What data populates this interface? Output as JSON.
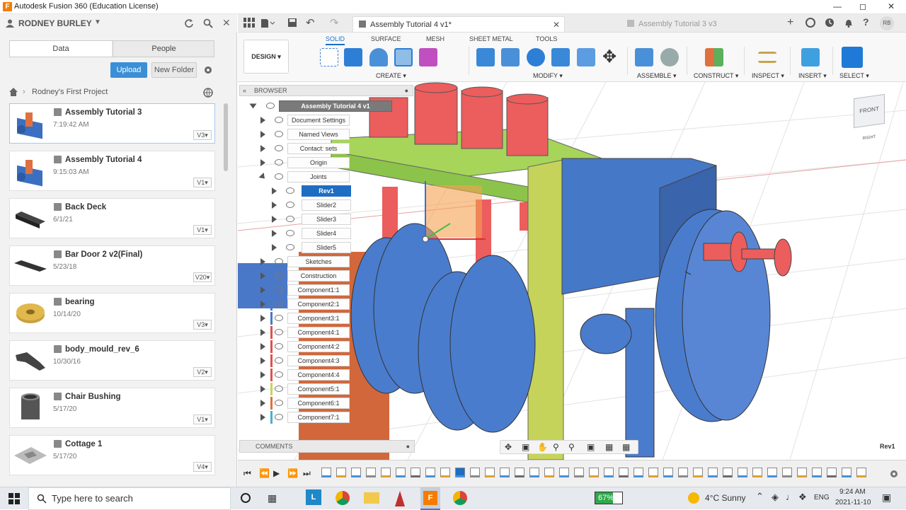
{
  "app": {
    "title": "Autodesk Fusion 360 (Education License)"
  },
  "user": {
    "name": "RODNEY BURLEY"
  },
  "data_panel": {
    "tabs": [
      "Data",
      "People"
    ],
    "upload_label": "Upload",
    "new_folder_label": "New Folder",
    "project": "Rodney's First Project",
    "files": [
      {
        "name": "Assembly Tutorial 3",
        "date": "7:19:42 AM",
        "version": "V3"
      },
      {
        "name": "Assembly Tutorial 4",
        "date": "9:15:03 AM",
        "version": "V1"
      },
      {
        "name": "Back Deck",
        "date": "6/1/21",
        "version": "V1"
      },
      {
        "name": "Bar Door 2 v2(Final)",
        "date": "5/23/18",
        "version": "V20"
      },
      {
        "name": "bearing",
        "date": "10/14/20",
        "version": "V3"
      },
      {
        "name": "body_mould_rev_6",
        "date": "10/30/16",
        "version": "V2"
      },
      {
        "name": "Chair Bushing",
        "date": "5/17/20",
        "version": "V1"
      },
      {
        "name": "Cottage 1",
        "date": "5/17/20",
        "version": "V4"
      }
    ]
  },
  "doc_tabs": [
    {
      "label": "Assembly Tutorial 4 v1*",
      "active": true
    },
    {
      "label": "Assembly Tutorial 3 v3",
      "active": false
    }
  ],
  "user_initials": "RB",
  "ribbon": {
    "tabs": [
      "SOLID",
      "SURFACE",
      "MESH",
      "SHEET METAL",
      "TOOLS"
    ],
    "workspace": "DESIGN",
    "groups": [
      "CREATE",
      "MODIFY",
      "ASSEMBLE",
      "CONSTRUCT",
      "INSPECT",
      "INSERT",
      "SELECT"
    ]
  },
  "browser": {
    "title": "BROWSER",
    "root": "Assembly Tutorial 4 v1",
    "items": [
      {
        "label": "Document Settings"
      },
      {
        "label": "Named Views"
      },
      {
        "label": "Contact: sets"
      },
      {
        "label": "Origin"
      },
      {
        "label": "Joints"
      },
      {
        "label": "Rev1"
      },
      {
        "label": "Slider2"
      },
      {
        "label": "Slider3"
      },
      {
        "label": "Slider4"
      },
      {
        "label": "Slider5"
      },
      {
        "label": "Sketches"
      },
      {
        "label": "Construction"
      },
      {
        "label": "Component1:1"
      },
      {
        "label": "Component2:1"
      },
      {
        "label": "Component3:1"
      },
      {
        "label": "Component4:1"
      },
      {
        "label": "Component4:2"
      },
      {
        "label": "Component4:3"
      },
      {
        "label": "Component4:4"
      },
      {
        "label": "Component5:1"
      },
      {
        "label": "Component6:1"
      },
      {
        "label": "Component7:1"
      }
    ]
  },
  "viewcube": {
    "label": "FRONT",
    "side": "RIGHT"
  },
  "comments_label": "COMMENTS",
  "status_right": "Rev1",
  "taskbar": {
    "search_placeholder": "Type here to search",
    "battery": "67%",
    "weather": "4°C  Sunny",
    "lang": "ENG",
    "time": "9:24 AM",
    "date": "2021-11-10"
  }
}
